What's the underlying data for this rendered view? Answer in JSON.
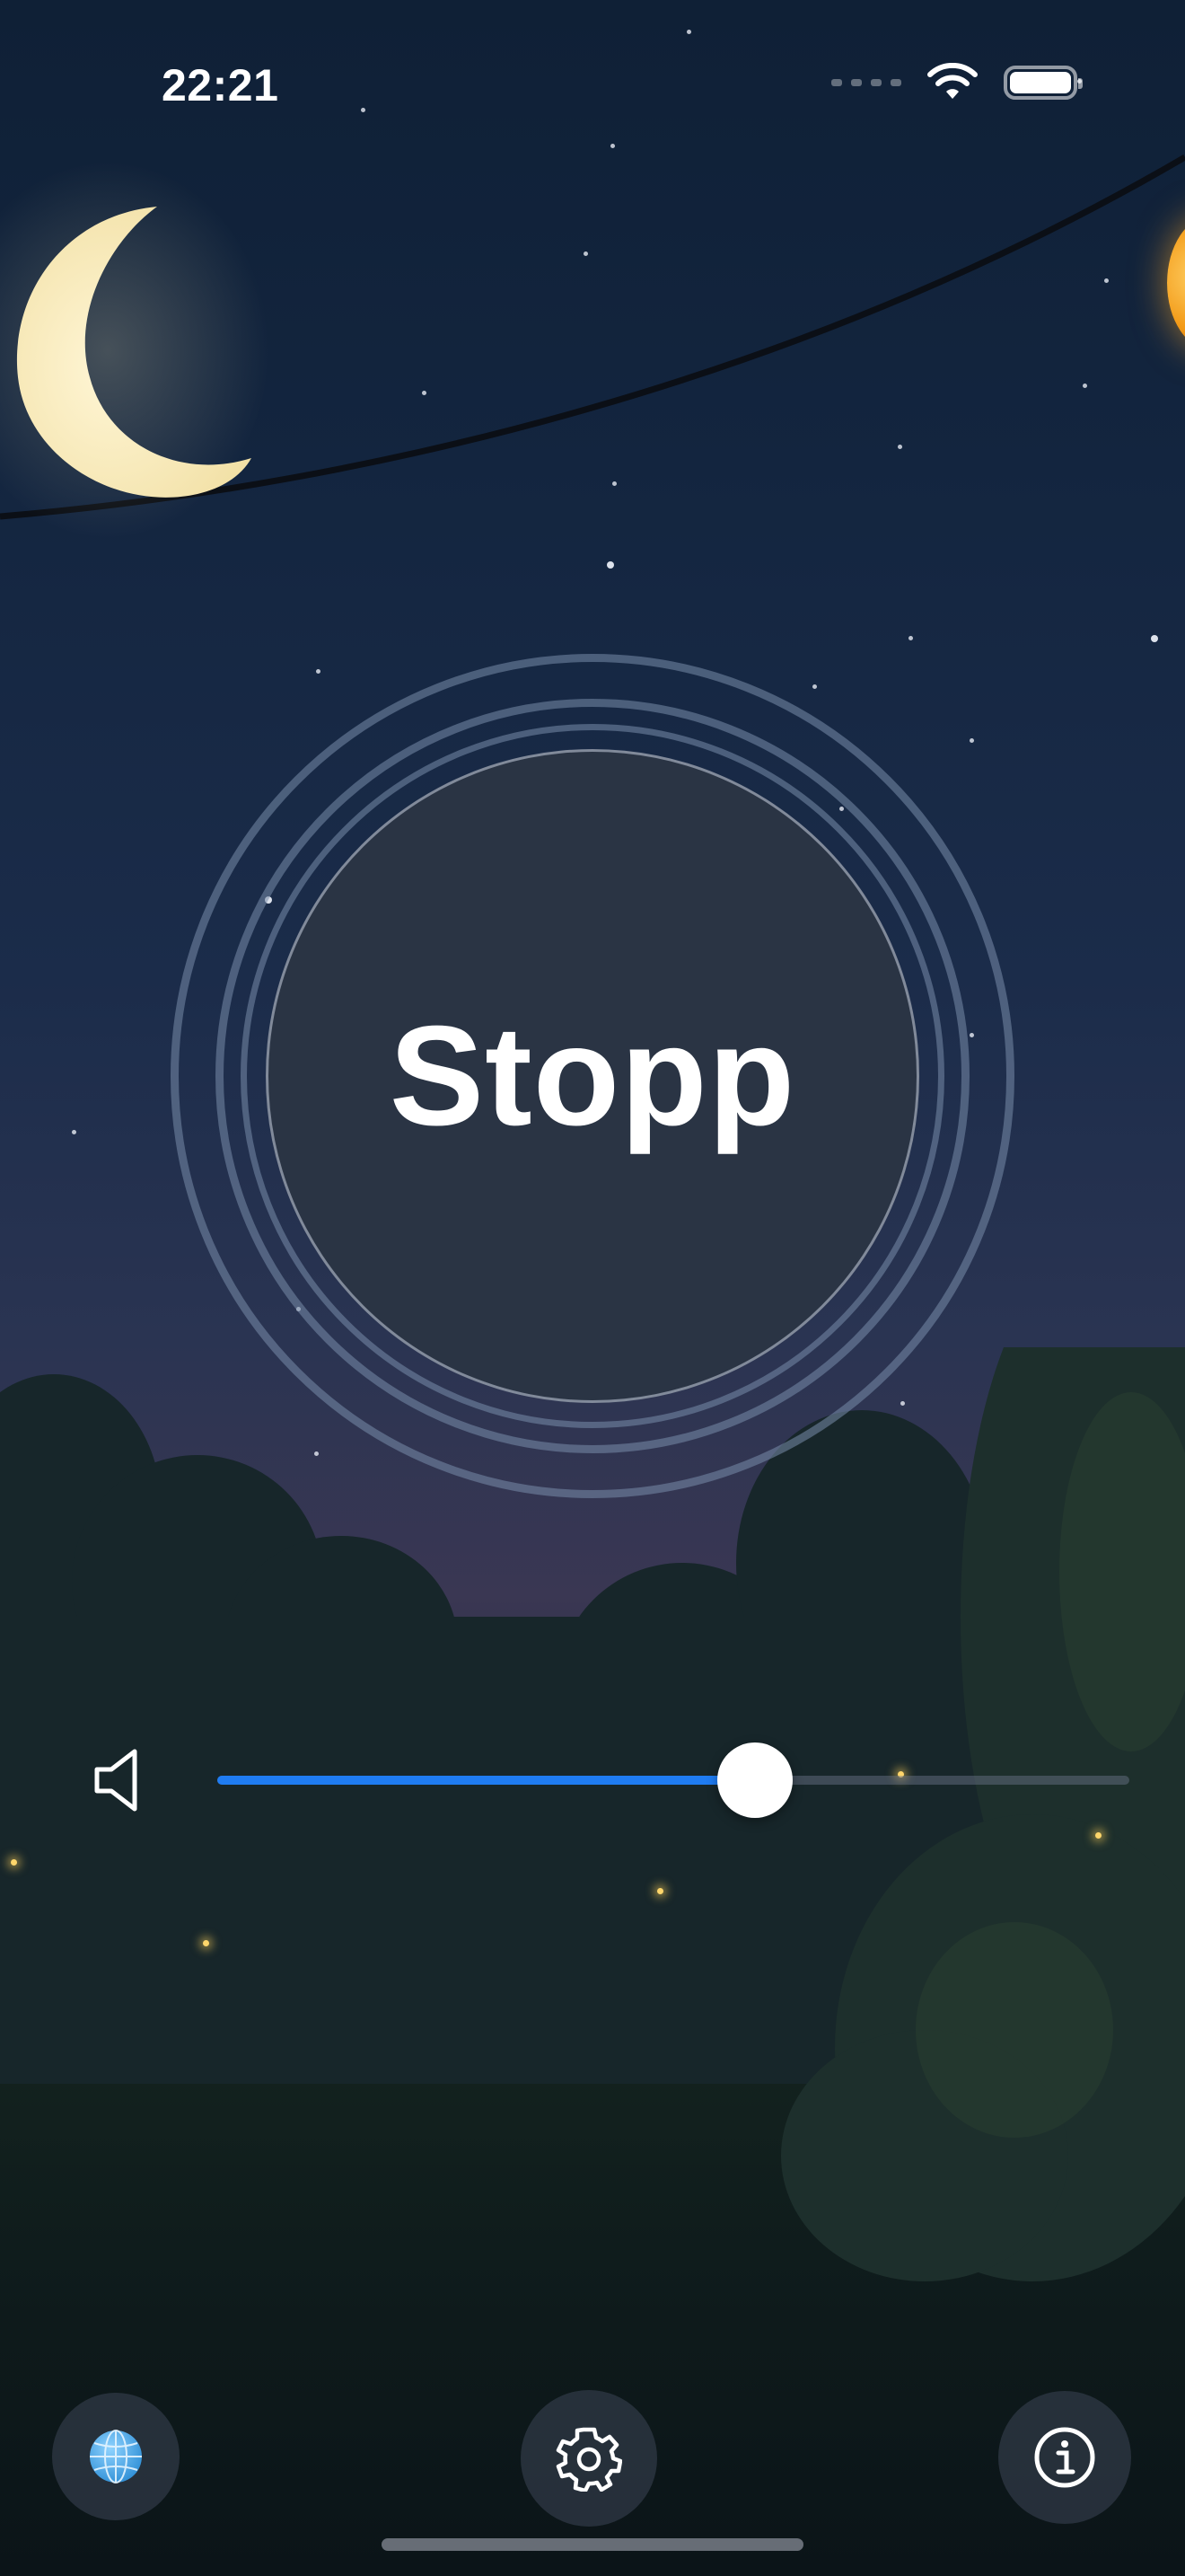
{
  "status_bar": {
    "time": "22:21"
  },
  "main": {
    "stop_label": "Stopp"
  },
  "volume": {
    "level": 0.59
  },
  "toolbar": {
    "language_icon": "globe-icon",
    "settings_icon": "gear-icon",
    "info_icon": "info-icon"
  },
  "colors": {
    "accent": "#1f7cf2",
    "button_fill": "#2a3444"
  }
}
